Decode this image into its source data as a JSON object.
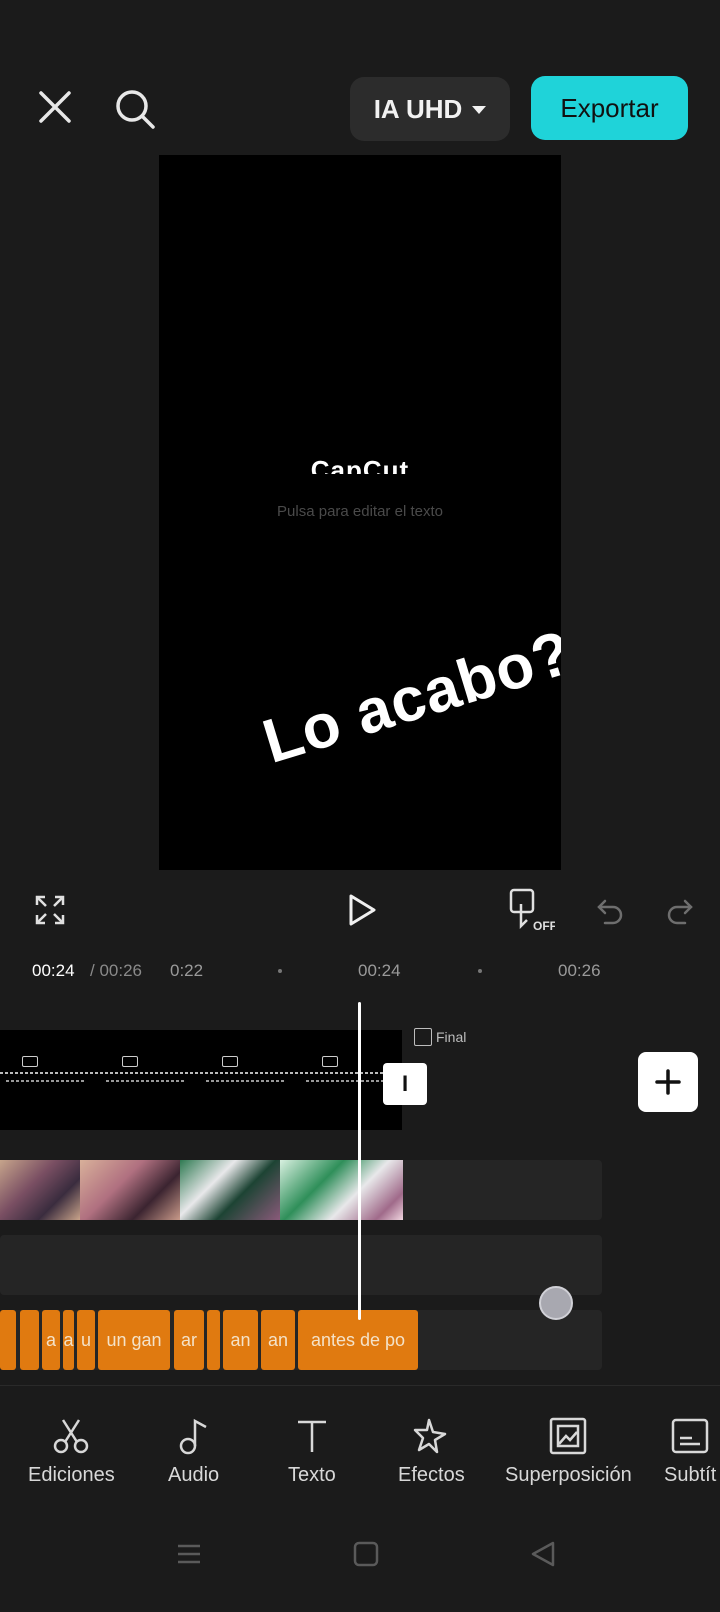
{
  "header": {
    "quality_label": "IA UHD",
    "export_label": "Exportar"
  },
  "preview": {
    "logo_text": "CapCut",
    "hint": "Pulsa para editar el texto",
    "overlay_text": "Lo acabo?"
  },
  "timeline": {
    "current_time": "00:24",
    "total_time": "/ 00:26",
    "ruler": [
      "0:22",
      "00:24",
      "00:26"
    ],
    "final_label": "Final",
    "handle_label": "I",
    "captions": [
      "a",
      "a",
      "u",
      "un gan",
      "ar",
      "an",
      "an",
      "antes de po"
    ]
  },
  "toolbar": {
    "items": [
      {
        "label": "Ediciones",
        "icon": "scissors-icon"
      },
      {
        "label": "Audio",
        "icon": "music-note-icon"
      },
      {
        "label": "Texto",
        "icon": "text-icon"
      },
      {
        "label": "Efectos",
        "icon": "sparkle-icon"
      },
      {
        "label": "Superposición",
        "icon": "overlay-icon"
      },
      {
        "label": "Subtít",
        "icon": "subtitles-icon"
      }
    ]
  },
  "colors": {
    "accent": "#1fd3d9",
    "caption_clip": "#e07a10",
    "background": "#1b1b1b"
  }
}
